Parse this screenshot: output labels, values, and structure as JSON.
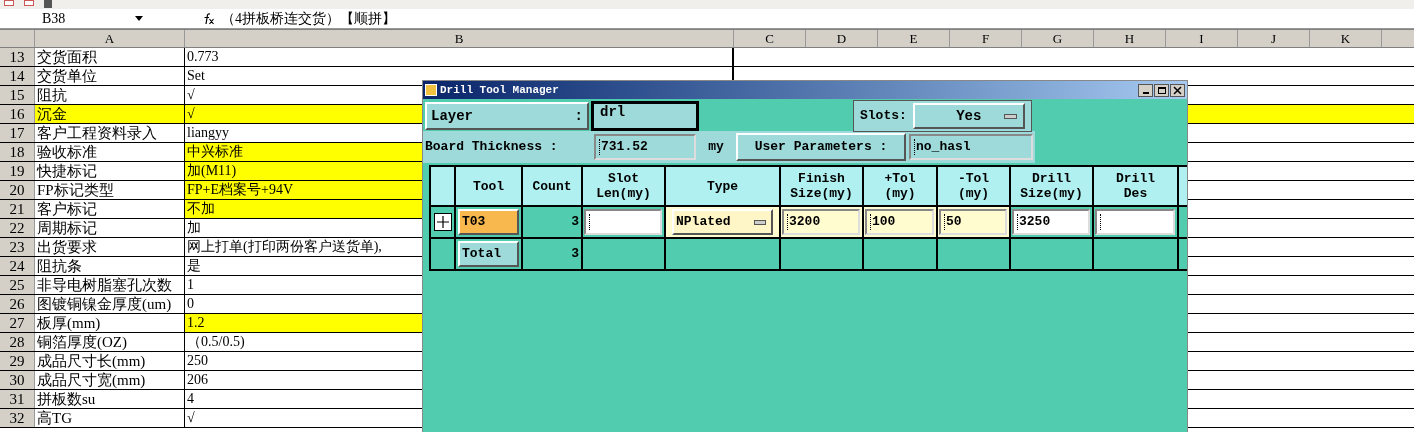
{
  "formula_bar": {
    "cell": "B38",
    "formula": "（4拼板桥连交货）【顺拼】"
  },
  "columns": [
    "A",
    "B",
    "C",
    "D",
    "E",
    "F",
    "G",
    "H",
    "I",
    "J",
    "K"
  ],
  "rows": [
    {
      "number": "13",
      "a": "交货面积",
      "b": "0.773",
      "row_highlighted": false,
      "value_highlighted": false
    },
    {
      "number": "14",
      "a": "交货单位",
      "b": "Set",
      "row_highlighted": false,
      "value_highlighted": false
    },
    {
      "number": "15",
      "a": "阻抗",
      "b": "√",
      "row_highlighted": false,
      "value_highlighted": false
    },
    {
      "number": "16",
      "a": "沉金",
      "b": "√",
      "row_highlighted": true,
      "value_highlighted": true
    },
    {
      "number": "17",
      "a": "客户工程资料录入",
      "b": "liangyy",
      "row_highlighted": false,
      "value_highlighted": false
    },
    {
      "number": "18",
      "a": "验收标准",
      "b": "中兴标准",
      "row_highlighted": false,
      "value_highlighted": true
    },
    {
      "number": "19",
      "a": "快捷标记",
      "b": "加(M11)",
      "row_highlighted": false,
      "value_highlighted": true
    },
    {
      "number": "20",
      "a": "FP标记类型",
      "b": "FP+E档案号+94V",
      "row_highlighted": false,
      "value_highlighted": true
    },
    {
      "number": "21",
      "a": "客户标记",
      "b": "不加",
      "row_highlighted": false,
      "value_highlighted": true
    },
    {
      "number": "22",
      "a": "周期标记",
      "b": "加",
      "row_highlighted": false,
      "value_highlighted": false
    },
    {
      "number": "23",
      "a": "出货要求",
      "b": "网上打单(打印两份客户送货单),",
      "row_highlighted": false,
      "value_highlighted": false
    },
    {
      "number": "24",
      "a": "阻抗条",
      "b": "是",
      "row_highlighted": false,
      "value_highlighted": false
    },
    {
      "number": "25",
      "a": "非导电树脂塞孔次数",
      "b": "1",
      "row_highlighted": false,
      "value_highlighted": false
    },
    {
      "number": "26",
      "a": "图镀铜镍金厚度(um)",
      "b": "0",
      "row_highlighted": false,
      "value_highlighted": false
    },
    {
      "number": "27",
      "a": "板厚(mm)",
      "b": "1.2",
      "row_highlighted": false,
      "value_highlighted": true
    },
    {
      "number": "28",
      "a": "铜箔厚度(OZ)",
      "b": "（0.5/0.5)",
      "row_highlighted": false,
      "value_highlighted": false
    },
    {
      "number": "29",
      "a": "成品尺寸长(mm)",
      "b": "250",
      "row_highlighted": false,
      "value_highlighted": false
    },
    {
      "number": "30",
      "a": "成品尺寸宽(mm)",
      "b": "206",
      "row_highlighted": false,
      "value_highlighted": false
    },
    {
      "number": "31",
      "a": "拼板数su",
      "b": "4",
      "row_highlighted": false,
      "value_highlighted": false
    },
    {
      "number": "32",
      "a": "高TG",
      "b": "√",
      "row_highlighted": false,
      "value_highlighted": false
    }
  ],
  "dialog": {
    "title": "Drill Tool Manager",
    "layer": {
      "label": "Layer",
      "colon": ":",
      "value": "drl"
    },
    "slots": {
      "label": "Slots:",
      "value": "Yes"
    },
    "board_thickness": {
      "label": "Board Thickness :",
      "value": "731.52",
      "unit": "my"
    },
    "user_parameters": {
      "label": "User Parameters :",
      "value": "no_hasl"
    },
    "table": {
      "columns": [
        "Tool",
        "Count",
        "Slot\nLen(my)",
        "Type",
        "Finish\nSize(my)",
        "+Tol\n(my)",
        "-Tol\n(my)",
        "Drill\nSize(my)",
        "Drill\nDes"
      ],
      "tools": [
        {
          "tool": "T03",
          "selected": true,
          "count": "3",
          "type": "NPlated",
          "finish": "3200",
          "plus_tol": "100",
          "minus_tol": "50",
          "drill_size": "3250"
        }
      ],
      "total": {
        "label": "Total",
        "count": "3"
      }
    }
  }
}
